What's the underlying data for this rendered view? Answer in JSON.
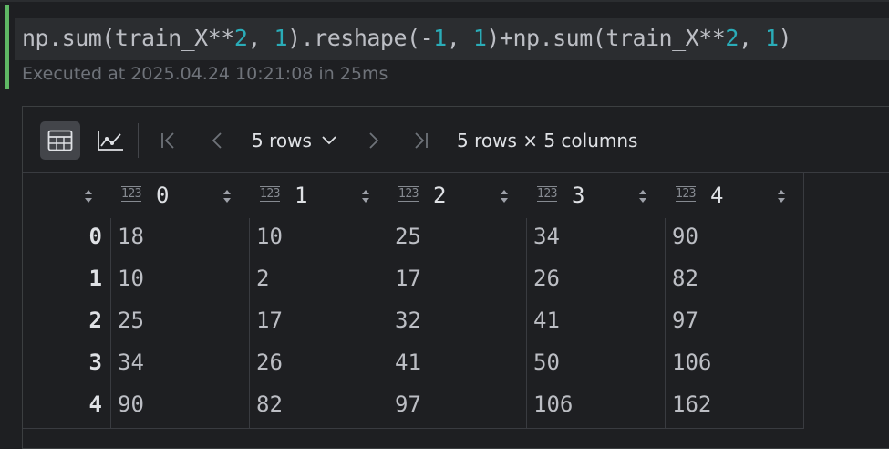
{
  "code_cell": {
    "tokens": [
      {
        "text": "np.sum(train_X**",
        "kind": "plain"
      },
      {
        "text": "2",
        "kind": "num"
      },
      {
        "text": ", ",
        "kind": "plain"
      },
      {
        "text": "1",
        "kind": "num"
      },
      {
        "text": ").reshape(-",
        "kind": "plain"
      },
      {
        "text": "1",
        "kind": "num"
      },
      {
        "text": ", ",
        "kind": "plain"
      },
      {
        "text": "1",
        "kind": "num"
      },
      {
        "text": ")+np.sum(train_X**",
        "kind": "plain"
      },
      {
        "text": "2",
        "kind": "num"
      },
      {
        "text": ", ",
        "kind": "plain"
      },
      {
        "text": "1",
        "kind": "num"
      },
      {
        "text": ")",
        "kind": "plain"
      }
    ],
    "status": "Executed at 2025.04.24 10:21:08 in 25ms"
  },
  "toolbar": {
    "table_view_icon": "table-icon",
    "chart_view_icon": "line-chart-icon",
    "rows_label": "5 rows",
    "summary": "5 rows × 5 columns"
  },
  "table": {
    "columns": [
      "0",
      "1",
      "2",
      "3",
      "4"
    ],
    "index": [
      "0",
      "1",
      "2",
      "3",
      "4"
    ],
    "rows": [
      [
        "18",
        "10",
        "25",
        "34",
        "90"
      ],
      [
        "10",
        "2",
        "17",
        "26",
        "82"
      ],
      [
        "25",
        "17",
        "32",
        "41",
        "97"
      ],
      [
        "34",
        "26",
        "41",
        "50",
        "106"
      ],
      [
        "90",
        "82",
        "97",
        "106",
        "162"
      ]
    ],
    "column_type_label": "123"
  },
  "colors": {
    "accent_green": "#5fb865",
    "number_teal": "#2aacb8",
    "background": "#1e1f22"
  }
}
